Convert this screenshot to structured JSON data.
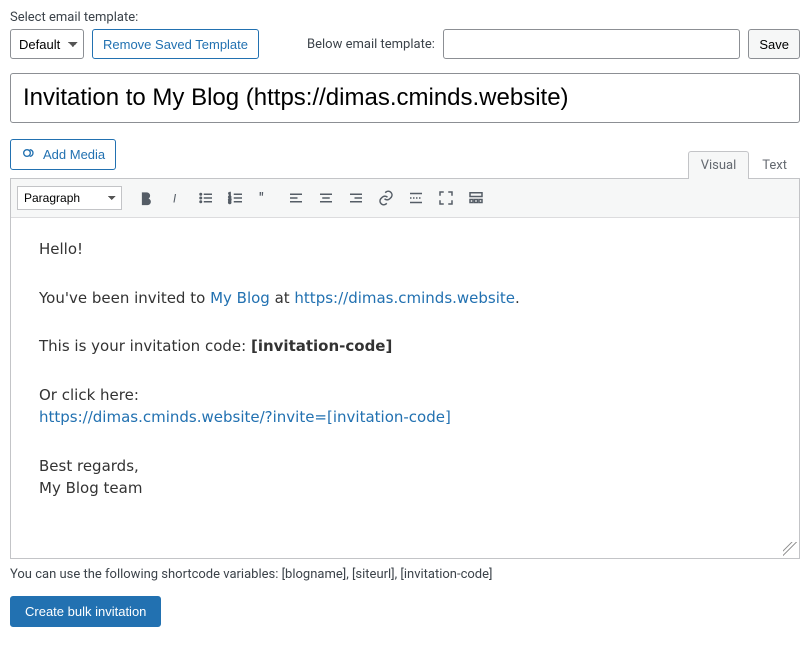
{
  "top": {
    "select_label": "Select email template:",
    "template_options": [
      "Default"
    ],
    "template_selected": "Default",
    "remove_label": "Remove Saved Template",
    "below_label": "Below email template:",
    "below_value": "",
    "save_label": "Save"
  },
  "subject": "Invitation to My Blog (https://dimas.cminds.website)",
  "media_button": "Add Media",
  "tabs": {
    "visual": "Visual",
    "text": "Text",
    "active": "visual"
  },
  "toolbar": {
    "format_selected": "Paragraph",
    "format_options": [
      "Paragraph"
    ]
  },
  "body": {
    "greeting": "Hello!",
    "invited_pre": "You've been invited to ",
    "blog_link": "My Blog",
    "at": " at ",
    "site_link": "https://dimas.cminds.website",
    "period": ".",
    "code_line_pre": "This is your invitation code: ",
    "code_placeholder": "[invitation-code]",
    "click_here": "Or click here:",
    "invite_link": "https://dimas.cminds.website/?invite=[invitation-code]",
    "regards": "Best regards,",
    "team": "My Blog team"
  },
  "hint": "You can use the following shortcode variables: [blogname], [siteurl], [invitation-code]",
  "submit": "Create bulk invitation"
}
